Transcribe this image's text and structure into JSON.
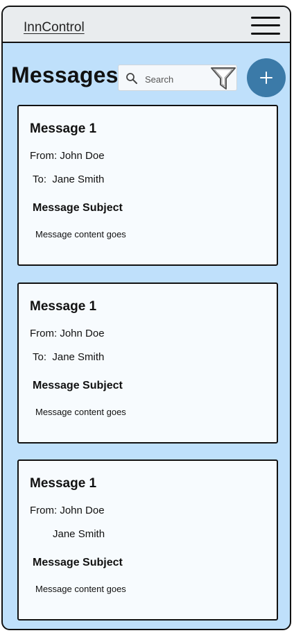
{
  "app": {
    "name": "InnControl"
  },
  "header": {
    "title": "Messages"
  },
  "search": {
    "placeholder": "Search"
  },
  "messages": [
    {
      "title": "Message 1",
      "from_label": "From:",
      "from": "John Doe",
      "to_label": "To:",
      "to": "Jane Smith",
      "subject": "Message Subject",
      "content": "Message content goes"
    },
    {
      "title": "Message 1",
      "from_label": "From:",
      "from": "John Doe",
      "to_label": "To:",
      "to": "Jane Smith",
      "subject": "Message Subject",
      "content": "Message content goes"
    },
    {
      "title": "Message 1",
      "from_label": "From:",
      "from": "John Doe",
      "to_label": "",
      "to": "Jane Smith",
      "subject": "Message Subject",
      "content": "Message content goes"
    }
  ],
  "icons": {
    "menu": "hamburger-menu-icon",
    "search": "search-icon",
    "filter": "filter-funnel-icon",
    "add": "plus-icon"
  },
  "colors": {
    "background": "#bfe0fb",
    "topbar": "#e9ecee",
    "fab": "#3b7aa8",
    "card": "#f7fbfe"
  }
}
